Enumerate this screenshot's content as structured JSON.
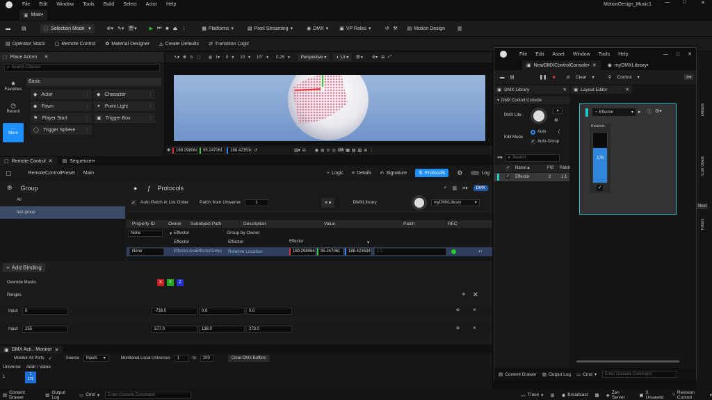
{
  "menu": {
    "items": [
      "File",
      "Edit",
      "Window",
      "Tools",
      "Build",
      "Select",
      "Actor",
      "Help"
    ],
    "project": "MotionDesign_Music1"
  },
  "level_tab": {
    "label": "Main•"
  },
  "toolbar": {
    "mode": "Selection Mode",
    "platforms": "Platforms",
    "pixel_streaming": "Pixel Streaming",
    "dmx": "DMX",
    "vp_roles": "VP Roles",
    "motion_design": "Motion Design"
  },
  "subtoolbar": {
    "items": [
      "Operator Stack",
      "Remote Control",
      "Material Designer",
      "Create Defaults",
      "Transition Logic"
    ]
  },
  "place_actors": {
    "title": "Place Actors",
    "search_placeholder": "Search Classes",
    "categories": [
      "Favorites",
      "Recent",
      "More"
    ],
    "section": "Basic",
    "items": [
      "Actor",
      "Character",
      "Pawn",
      "Point Light",
      "Player Start",
      "Trigger Box",
      "Trigger Sphere"
    ]
  },
  "viewport": {
    "toolbar": {
      "snap_deg": "10°",
      "val0": "0",
      "val10": "10",
      "scale": "0.25",
      "perspective": "Perspective",
      "lit": "Lit"
    },
    "coords": [
      "169.298064",
      "95.247061",
      "188.423534"
    ]
  },
  "remote_control": {
    "tabs": [
      "Remote Control",
      "Sequencer•"
    ],
    "preset_label": "RemoteControlPreset",
    "preset_name": "Main",
    "mode_buttons": [
      "Logic",
      "Details",
      "Signature",
      "Protocols",
      "Log"
    ],
    "group_title": "Group",
    "groups": [
      "All",
      "test group"
    ],
    "protocols_title": "Protocols",
    "dmx_badge": "DMX",
    "auto_patch_label": "Auto Patch in List Order",
    "patch_from_universe_label": "Patch from Universe",
    "patch_from_universe_value": "1",
    "library_label": "DMXLibrary",
    "library_value": "myDMXLibrary",
    "columns": [
      "Property ID",
      "Owner",
      "Subobject Path",
      "Description",
      "Value",
      "Patch",
      "REC"
    ],
    "row1": {
      "property_id": "None",
      "owner": "Effector",
      "desc": "Group by Owner"
    },
    "row2": {
      "owner": "Effector",
      "desc": "Effector",
      "value": "Effector"
    },
    "row3": {
      "property_id": "None",
      "owner": "Effector.AvaEffectorComp",
      "desc": "Relative Location",
      "values": [
        "169.298064",
        "95.247061",
        "188.423534"
      ],
      "patch": "1.1"
    },
    "add_binding": "Add Binding",
    "override_masks": "Override Masks",
    "masks": [
      "X",
      "Y",
      "Z"
    ],
    "ranges_label": "Ranges",
    "range_rows": [
      {
        "label": "Input",
        "input": "0",
        "values": [
          "-739.0",
          "0.0",
          "0.0"
        ]
      },
      {
        "label": "Input",
        "input": "255",
        "values": [
          "577.0",
          "138.0",
          "273.0"
        ]
      }
    ]
  },
  "dmx_monitor": {
    "title": "DMX Acti.. Monitor",
    "monitor_all_ports": "Monitor All Ports",
    "source_label": "Source",
    "source_value": "Inputs",
    "monitored_label": "Monitored Local Universes",
    "from": "1",
    "to_label": "to",
    "to": "100",
    "clear_button": "Clear DMX Buffers",
    "headers": [
      "Universe",
      "Addr / Value"
    ],
    "universe": "1",
    "cell_addr": "1",
    "cell_value": "176"
  },
  "bottom_bar": {
    "content_drawer": "Content Drawer",
    "output_log": "Output Log",
    "cmd": "Cmd",
    "console_placeholder": "Enter Console Command",
    "trace": "Trace",
    "broadcast": "Broadcast",
    "zen_server": "Zen Server",
    "unsaved": "3 Unsaved",
    "revision": "Revision Control"
  },
  "right_edge": {
    "tabs": [
      "Details",
      "Cue Stack",
      "Filters"
    ],
    "next": "Next"
  },
  "dmx_window": {
    "menu": [
      "File",
      "Edit",
      "Asset",
      "Window",
      "Tools",
      "Help"
    ],
    "tabs": [
      "NewDMXControlConsole•",
      "myDMXLibrary•"
    ],
    "clear": "Clear",
    "control": "Control",
    "library_tab": "DMX Library",
    "layout_tab": "Layout Editor",
    "console_section": "DMX Control Console",
    "dmx_library_label": "DMX Libr..",
    "edit_mode_label": "Edit Mode",
    "auto_label": "Auto",
    "auto_group_label": "Auto-Group",
    "search_placeholder": "Search",
    "list_headers": [
      "Name",
      "FID",
      "Patch"
    ],
    "list_row": {
      "name": "Effector",
      "fid": "2",
      "patch": "1.1"
    },
    "fader_group_name": "Effector",
    "fader_label": "RelativeL",
    "fader_value": "176",
    "fader_fraction": 0.69,
    "bottom": {
      "content_drawer": "Content Drawer",
      "output_log": "Output Log",
      "cmd": "Cmd",
      "console_placeholder": "Enter Console Command"
    }
  },
  "colors": {
    "accent": "#1e8fff",
    "teal": "#1fc8c8",
    "rec_green": "#22cc22",
    "play_green": "#2fbf2f",
    "stop_red": "#d33"
  }
}
